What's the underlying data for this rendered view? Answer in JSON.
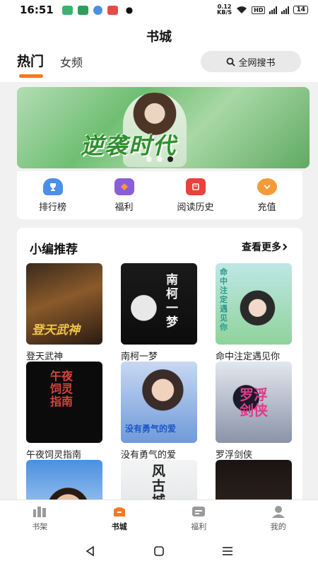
{
  "status_bar": {
    "time": "16:51",
    "speed_value": "0.12",
    "speed_unit": "KB/S",
    "hd": "HD",
    "battery": "14"
  },
  "header": {
    "title": "书城",
    "tabs": [
      {
        "label": "热门"
      },
      {
        "label": "女频"
      }
    ],
    "search_label": "全网搜书"
  },
  "banner": {
    "title": "逆袭时代"
  },
  "quick_entries": [
    {
      "label": "排行榜",
      "icon": "trophy-icon"
    },
    {
      "label": "福利",
      "icon": "gift-icon"
    },
    {
      "label": "阅读历史",
      "icon": "history-icon"
    },
    {
      "label": "充值",
      "icon": "recharge-icon"
    }
  ],
  "recommend": {
    "title": "小编推荐",
    "see_more": "查看更多",
    "books": [
      {
        "name": "登天武神",
        "cover_text": "登天武神"
      },
      {
        "name": "南柯一梦",
        "cover_text": "南柯一梦"
      },
      {
        "name": "命中注定遇见你",
        "cover_text": "命中注定遇见你"
      },
      {
        "name": "午夜饲灵指南",
        "cover_text": "午夜饲灵指南"
      },
      {
        "name": "没有勇气的爱",
        "cover_text": "没有勇气的爱"
      },
      {
        "name": "罗浮剑侠",
        "cover_text": "罗浮剑侠"
      },
      {
        "name": "",
        "cover_text": ""
      },
      {
        "name": "",
        "cover_text": "风古城"
      },
      {
        "name": "",
        "cover_text": ""
      }
    ]
  },
  "bottom_nav": [
    {
      "label": "书架"
    },
    {
      "label": "书城"
    },
    {
      "label": "福利"
    },
    {
      "label": "我的"
    }
  ],
  "colors": {
    "accent": "#f47920",
    "background": "#f1f1f1"
  }
}
